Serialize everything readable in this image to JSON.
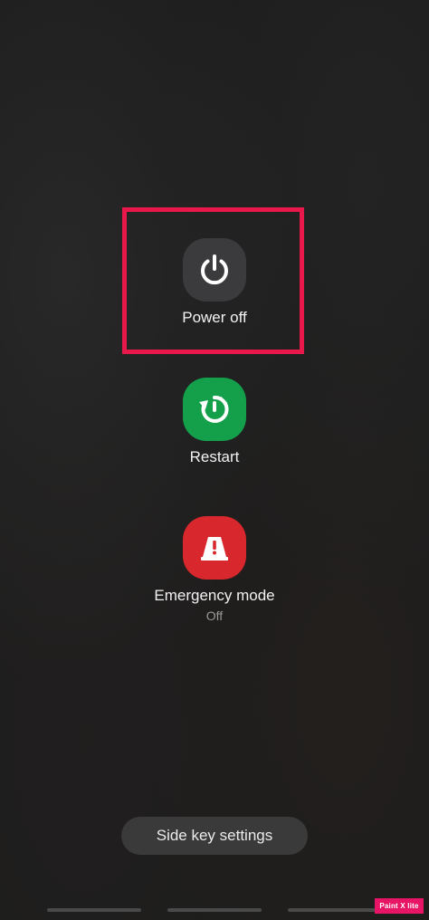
{
  "actions": {
    "power_off": {
      "label": "Power off",
      "icon": "power-icon",
      "color": "#3b3b3d"
    },
    "restart": {
      "label": "Restart",
      "icon": "restart-icon",
      "color": "#14a04b"
    },
    "emergency": {
      "label": "Emergency mode",
      "status": "Off",
      "icon": "emergency-siren-icon",
      "color": "#d9282d"
    }
  },
  "side_key_settings": {
    "label": "Side key settings"
  },
  "highlight": {
    "color": "#e8194a"
  },
  "watermark": {
    "text": "Paint X lite"
  }
}
